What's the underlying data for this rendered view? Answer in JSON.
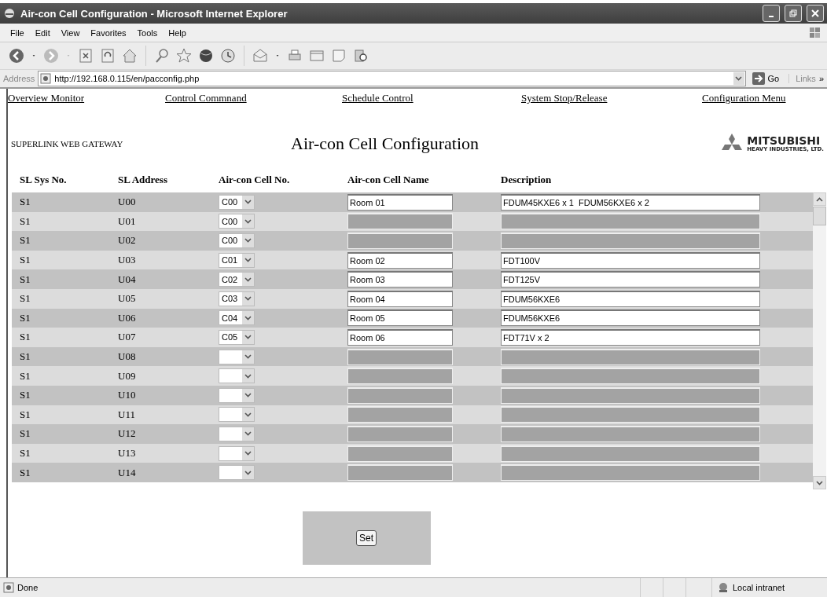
{
  "window": {
    "title": "Air-con Cell Configuration - Microsoft Internet Explorer"
  },
  "menu": [
    "File",
    "Edit",
    "View",
    "Favorites",
    "Tools",
    "Help"
  ],
  "address_bar": {
    "label": "Address",
    "url": "http://192.168.0.115/en/pacconfig.php",
    "go": "Go",
    "links": "Links",
    "more": "»"
  },
  "nav_links": [
    "Overview Monitor",
    "Control Commnand",
    "Schedule Control",
    "System Stop/Release",
    "Configuration Menu"
  ],
  "header": {
    "gateway": "SUPERLINK WEB GATEWAY",
    "title": "Air-con Cell Configuration",
    "logo_name": "MITSUBISHI",
    "logo_sub": "HEAVY INDUSTRIES, LTD."
  },
  "table": {
    "columns": [
      "SL Sys No.",
      "SL Address",
      "Air-con Cell No.",
      "Air-con Cell Name",
      "Description"
    ],
    "rows": [
      {
        "sys": "S1",
        "address": "U00",
        "cell": "C00",
        "name": "Room 01",
        "description": "FDUM45KXE6 x 1  FDUM56KXE6 x 2",
        "disabled": false
      },
      {
        "sys": "S1",
        "address": "U01",
        "cell": "C00",
        "disabled": true
      },
      {
        "sys": "S1",
        "address": "U02",
        "cell": "C00",
        "disabled": true
      },
      {
        "sys": "S1",
        "address": "U03",
        "cell": "C01",
        "name": "Room 02",
        "description": "FDT100V",
        "disabled": false
      },
      {
        "sys": "S1",
        "address": "U04",
        "cell": "C02",
        "name": "Room 03",
        "description": "FDT125V",
        "disabled": false
      },
      {
        "sys": "S1",
        "address": "U05",
        "cell": "C03",
        "name": "Room 04",
        "description": "FDUM56KXE6",
        "disabled": false
      },
      {
        "sys": "S1",
        "address": "U06",
        "cell": "C04",
        "name": "Room 05",
        "description": "FDUM56KXE6",
        "disabled": false
      },
      {
        "sys": "S1",
        "address": "U07",
        "cell": "C05",
        "name": "Room 06",
        "description": "FDT71V x 2",
        "disabled": false
      },
      {
        "sys": "S1",
        "address": "U08",
        "disabled": true
      },
      {
        "sys": "S1",
        "address": "U09",
        "disabled": true
      },
      {
        "sys": "S1",
        "address": "U10",
        "disabled": true
      },
      {
        "sys": "S1",
        "address": "U11",
        "disabled": true
      },
      {
        "sys": "S1",
        "address": "U12",
        "disabled": true
      },
      {
        "sys": "S1",
        "address": "U13",
        "disabled": true
      },
      {
        "sys": "S1",
        "address": "U14",
        "disabled": true
      }
    ]
  },
  "set_button": "Set",
  "status_bar": {
    "text": "Done",
    "zone": "Local intranet"
  }
}
